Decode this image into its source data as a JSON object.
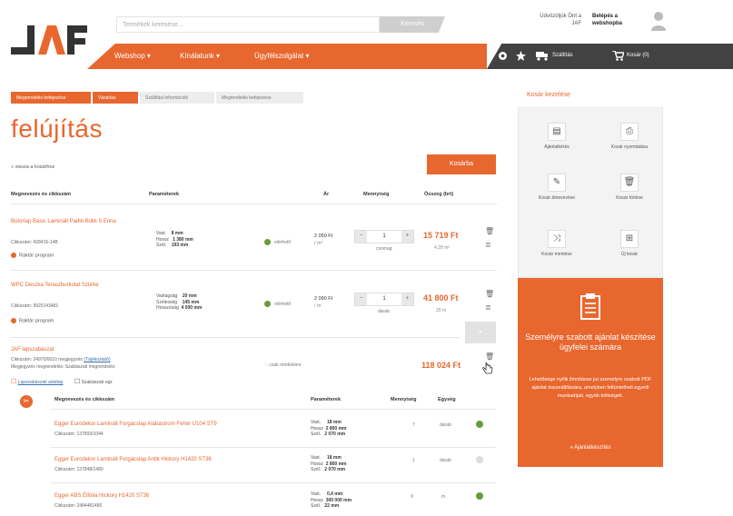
{
  "header": {
    "search_placeholder": "Termékek keresése...",
    "search_button": "Keresés",
    "account_link": "Üdvözöljük Önt a JAF",
    "login_link": "Belépés a webshopba",
    "nav": [
      "Webshop",
      "Kínálatunk",
      "Ügyfélszolgálat"
    ],
    "dark_items": [
      "Szállítás",
      "Kosár (0)"
    ],
    "colors": {
      "brand": "#e8672f",
      "dark": "#424242"
    }
  },
  "steps": [
    "Megrendelés befejezése",
    "Vásárlás",
    "Szállítási információk",
    "Megrendelés befejezése"
  ],
  "page": {
    "title": "felújítás",
    "back_link": "« vissza a kosárhoz",
    "checkout_button": "Kosárba"
  },
  "table": {
    "headers": [
      "Megnevezés és cikkszám",
      "Paraméterek",
      "Ár",
      "Mennyiség",
      "Összeg (brt)"
    ],
    "rows": [
      {
        "name": "Bútorlap Basic Laminált Padló Bükk 5 Enna",
        "code": "Cikkszám: 428416-14B",
        "plan": "Raktár program",
        "params": [
          [
            "Vast.",
            "8 mm"
          ],
          [
            "Hossz",
            "1 380 mm"
          ],
          [
            "Szél.",
            "193 mm"
          ]
        ],
        "stock": "elérhető",
        "price": "2 050 Ft",
        "price_unit": "/ m²",
        "qty": "1",
        "unit": "csomag",
        "total": "15 719 Ft",
        "total_sub": "4,28 m²"
      },
      {
        "name": "WPC Deszka Teraszburkolat Szürke",
        "code": "Cikkszám: 9920143481",
        "plan": "Raktár program",
        "params": [
          [
            "Vastagság",
            "20 mm"
          ],
          [
            "Szélesség",
            "145 mm"
          ],
          [
            "Hosszúság",
            "4 000 mm"
          ]
        ],
        "stock": "elérhető",
        "price": "2 090 Ft",
        "price_unit": "/ m",
        "qty": "1",
        "unit": "darab",
        "total": "41 800 Ft",
        "total_sub": "20 m"
      },
      {
        "name": "JAF lapszabászat",
        "code": "Cikkszám: 24970/0010  megjegyzés",
        "code_link": "(Tájékoztató)",
        "extra": "Megjegyzés megrendelés: Szabászati megrendelés",
        "sub_link": "Lapszabászati adatlap",
        "sub_link2": "Szabászati rajz",
        "param": "csak rendelésre",
        "total": "118 024 Ft"
      }
    ]
  },
  "subtable": {
    "headers": [
      "Megnevezés és cikkszám",
      "Paraméterek",
      "Mennyiség",
      "Egység"
    ],
    "rows": [
      {
        "name": "Egger Eurodekor Laminált Forgácslap Alabástrom Fehér U104 ST9",
        "code": "Cikkszám: 137893/1044",
        "params": [
          [
            "Vast.",
            "18 mm"
          ],
          [
            "Hossz",
            "2 800 mm"
          ],
          [
            "Szél.",
            "2 070 mm"
          ]
        ],
        "qty": "7",
        "unit": "darab"
      },
      {
        "name": "Egger Eurodekor Laminált Forgácslap Antik Hickory H1420 ST36",
        "code": "Cikkszám: 137848/1480",
        "params": [
          [
            "Vast.",
            "18 mm"
          ],
          [
            "Hossz",
            "2 800 mm"
          ],
          [
            "Szél.",
            "2 070 mm"
          ]
        ],
        "qty": "1",
        "unit": "darab"
      },
      {
        "name": "Egger ABS Élfólia Hickory H1420 ST36",
        "code": "Cikkszám: 2484481480",
        "params": [
          [
            "Vast.",
            "0,4 mm"
          ],
          [
            "Hossz",
            "300 000 mm"
          ],
          [
            "Szél.",
            "22 mm"
          ]
        ],
        "qty": "9",
        "unit": "m"
      }
    ]
  },
  "sidebar": {
    "title": "Kosár kezelése",
    "items": [
      "Ajánlatkérés",
      "Kosár nyomtatása",
      "Kosár átnevezése",
      "Kosár törlése",
      "Kosár mentése",
      "Új kosár"
    ],
    "icons": [
      "clipboard-icon",
      "printer-icon",
      "pencil-icon",
      "trash-icon",
      "shuffle-icon",
      "add-cart-icon"
    ]
  },
  "offer": {
    "title": "Személyre szabott ajánlat készítése ügyfelei számára",
    "text": "Lehetősége nyílik ilmnitásse jut személyre szabott PDF ajánlat összeállítására, amelyben feltüntetheti egyedi munkadíjait, egyéb költségeit.",
    "link": "» Ajánlatkészítés"
  }
}
